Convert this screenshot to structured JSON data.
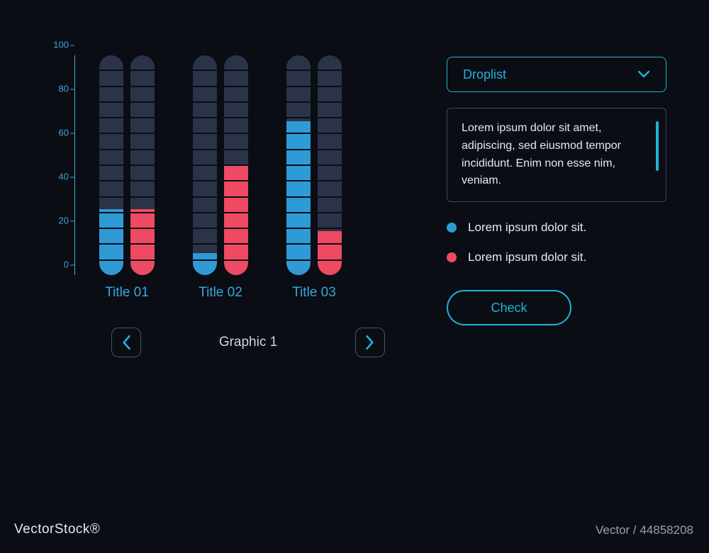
{
  "colors": {
    "blue": "#2f9bd6",
    "red": "#ef4a63",
    "accent": "#1fb3d8"
  },
  "chart_data": {
    "type": "bar",
    "categories": [
      "Title 01",
      "Title 02",
      "Title 03"
    ],
    "series": [
      {
        "name": "Lorem ipsum dolor sit.",
        "color": "blue",
        "values": [
          30,
          10,
          70
        ]
      },
      {
        "name": "Lorem ipsum dolor sit.",
        "color": "red",
        "values": [
          30,
          50,
          20
        ]
      }
    ],
    "ylabel": "",
    "ylim": [
      0,
      100
    ],
    "yticks": [
      0,
      20,
      40,
      60,
      80,
      100
    ],
    "title": "Graphic 1"
  },
  "nav": {
    "graphic_label": "Graphic 1"
  },
  "side": {
    "droplist_label": "Droplist",
    "textbox": "Lorem ipsum dolor sit amet, adipiscing, sed eiusmod tempor incididunt. Enim non esse nim, veniam.",
    "legend": [
      {
        "color": "blue",
        "text": "Lorem ipsum dolor sit."
      },
      {
        "color": "red",
        "text": "Lorem ipsum dolor sit."
      }
    ],
    "check_label": "Check"
  },
  "watermark": {
    "left": "VectorStock®",
    "right": "Vector / 44858208"
  }
}
